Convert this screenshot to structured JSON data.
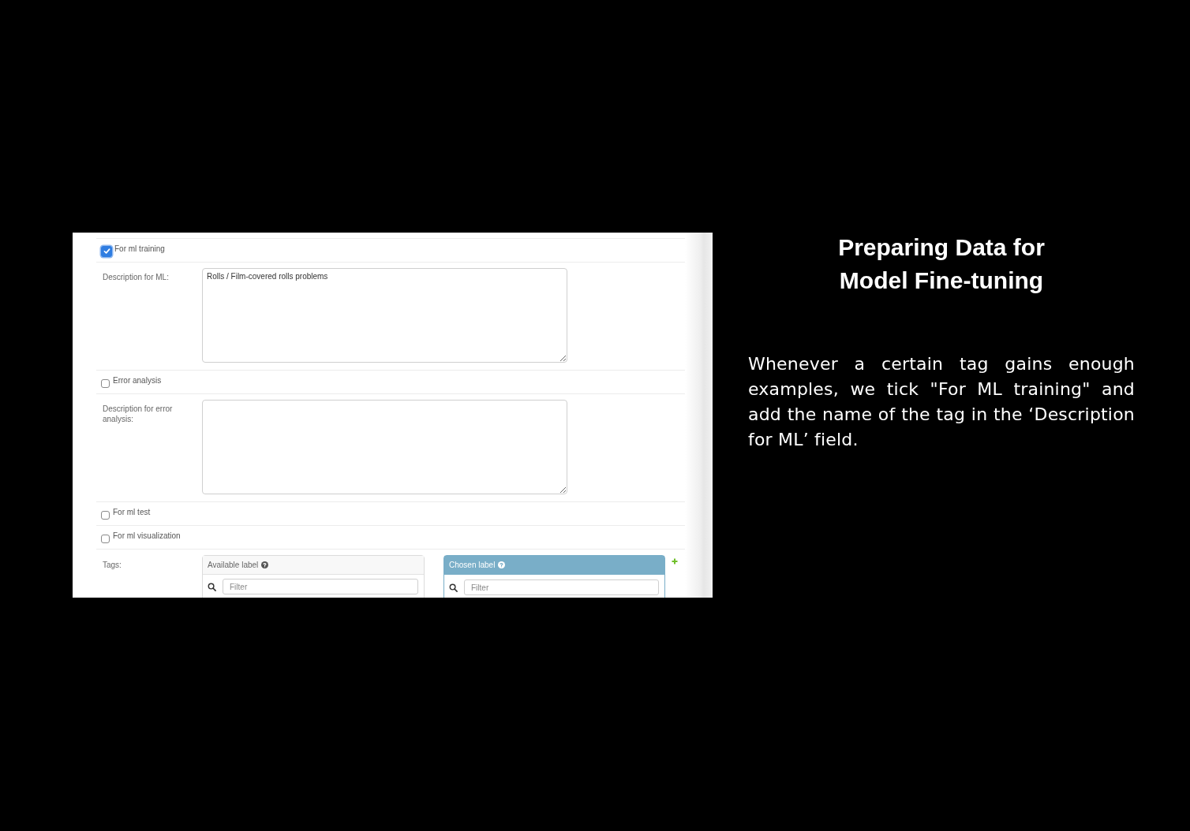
{
  "form": {
    "rows": [
      {
        "kind": "checkbox",
        "label": "For ml training",
        "checked": true
      },
      {
        "kind": "textarea",
        "label": "Description for ML:",
        "value": "Rolls / Film-covered rolls problems"
      },
      {
        "kind": "checkbox",
        "label": "Error analysis",
        "checked": false
      },
      {
        "kind": "textarea",
        "label": "Description for error analysis:"
      },
      {
        "kind": "checkbox",
        "label": "For ml test",
        "checked": false
      },
      {
        "kind": "checkbox",
        "label": "For ml visualization",
        "checked": false
      },
      {
        "kind": "selector",
        "label": "Tags:",
        "lists": [
          {
            "kind": "available",
            "title": "Available label",
            "filter_placeholder": "Filter"
          },
          {
            "kind": "chosen",
            "title": "Chosen label",
            "filter_placeholder": "Filter"
          }
        ]
      }
    ]
  },
  "slide": {
    "title": "Preparing Data for Model Fine-tuning",
    "body": "Whenever a certain tag gains enough examples, we tick \"For ML training\" and add the name of the tag in the ‘Description for ML’ field."
  }
}
